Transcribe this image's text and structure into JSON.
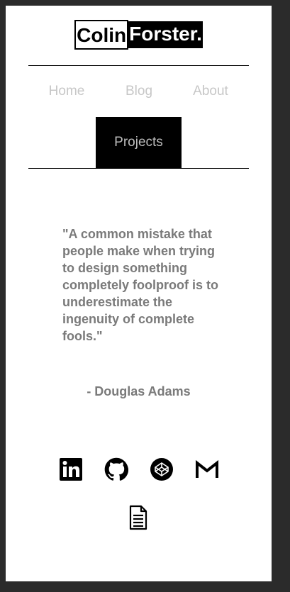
{
  "logo": {
    "first": "Colin",
    "last": "Forster."
  },
  "nav": {
    "home": "Home",
    "blog": "Blog",
    "about": "About",
    "projects": "Projects"
  },
  "quote": {
    "text": "\"A common mistake that people make when trying to design something completely foolproof is to underestimate the ingenuity of complete fools.\"",
    "author": "- Douglas Adams"
  },
  "social": [
    "linkedin-icon",
    "github-icon",
    "codepen-icon",
    "gmail-icon",
    "resume-document-icon"
  ],
  "colors": {
    "page_background": "#ffffff",
    "frame": "#2b2b2b",
    "accent": "#000000",
    "nav_text": "#c7c7c7",
    "quote_text": "#7a7a7a"
  }
}
